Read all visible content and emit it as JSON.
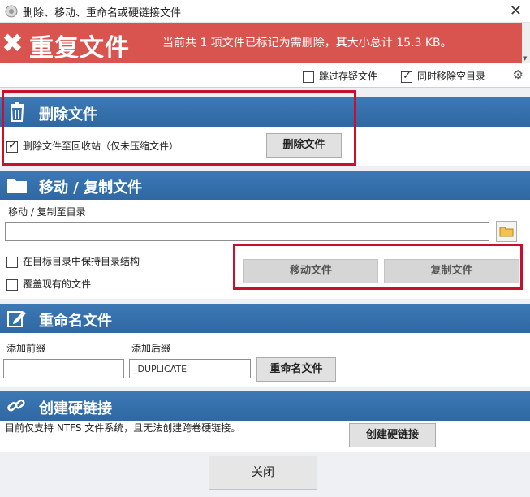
{
  "window": {
    "title": "删除、移动、重命名或硬链接文件",
    "close_glyph": "✕"
  },
  "banner": {
    "title": "重复文件",
    "info": "当前共 1 项文件已标记为需删除，其大小总计 15.3 KB。",
    "color": "#d9534f"
  },
  "options": {
    "skip_archive": {
      "label": "跳过存疑文件",
      "checked": false
    },
    "remove_empty_dirs": {
      "label": "同时移除空目录",
      "checked": true
    }
  },
  "delete_section": {
    "title": "删除文件",
    "recycle_label": "删除文件至回收站（仅未压缩文件）",
    "recycle_checked": true,
    "delete_button": "删除文件"
  },
  "move_section": {
    "title": "移动 / 复制文件",
    "target_label": "移动 / 复制至目录",
    "target_value": "",
    "keep_structure_label": "在目标目录中保持目录结构",
    "keep_structure_checked": false,
    "overwrite_label": "覆盖现有的文件",
    "overwrite_checked": false,
    "move_button": "移动文件",
    "copy_button": "复制文件"
  },
  "rename_section": {
    "title": "重命名文件",
    "prefix_label": "添加前缀",
    "prefix_value": "",
    "suffix_label": "添加后缀",
    "suffix_value": "_DUPLICATE",
    "rename_button": "重命名文件"
  },
  "hardlink_section": {
    "title": "创建硬链接",
    "note": "目前仅支持 NTFS 文件系统，且无法创建跨卷硬链接。",
    "create_button": "创建硬链接"
  },
  "footer": {
    "close_button": "关闭"
  },
  "colors": {
    "section_header": "#3d79b5",
    "highlight_box": "#c8102e"
  }
}
